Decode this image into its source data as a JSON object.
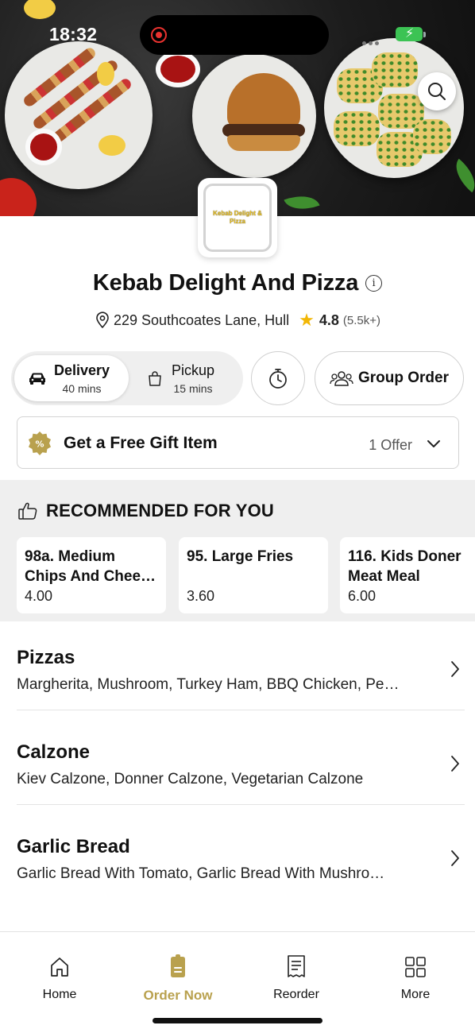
{
  "status_bar": {
    "time": "18:32"
  },
  "restaurant": {
    "logo_text": "Kebab Delight & Pizza",
    "name": "Kebab Delight And Pizza",
    "address": "229 Southcoates Lane, Hull",
    "rating": "4.8",
    "rating_count": "(5.5k+)"
  },
  "modes": {
    "delivery": {
      "label": "Delivery",
      "time": "40 mins",
      "selected": true
    },
    "pickup": {
      "label": "Pickup",
      "time": "15 mins",
      "selected": false
    }
  },
  "group_order": {
    "label": "Group Order"
  },
  "offer": {
    "title": "Get a Free Gift Item",
    "count": "1 Offer"
  },
  "recommended": {
    "title": "RECOMMENDED FOR YOU",
    "items": [
      {
        "line1": "98a. Medium",
        "line2": "Chips And Chee…",
        "price": "4.00"
      },
      {
        "line1": "95. Large Fries",
        "line2": "",
        "price": "3.60"
      },
      {
        "line1": "116. Kids Doner",
        "line2": "Meat Meal",
        "price": "6.00"
      }
    ]
  },
  "categories": [
    {
      "name": "Pizzas",
      "description": "Margherita, Mushroom, Turkey Ham, BBQ Chicken, Pe…"
    },
    {
      "name": "Calzone",
      "description": "Kiev Calzone, Donner Calzone, Vegetarian Calzone"
    },
    {
      "name": "Garlic Bread",
      "description": "Garlic Bread With Tomato, Garlic Bread With Mushro…"
    }
  ],
  "tabbar": {
    "items": [
      {
        "label": "Home",
        "icon": "house-icon",
        "active": false
      },
      {
        "label": "Order Now",
        "icon": "order-bag-icon",
        "active": true
      },
      {
        "label": "Reorder",
        "icon": "receipt-icon",
        "active": false
      },
      {
        "label": "More",
        "icon": "grid-icon",
        "active": false
      }
    ]
  },
  "colors": {
    "accent": "#b9a14e",
    "star": "#f2b705",
    "battery": "#3cc354",
    "record": "#e8322f",
    "section_bg": "#efefef"
  }
}
